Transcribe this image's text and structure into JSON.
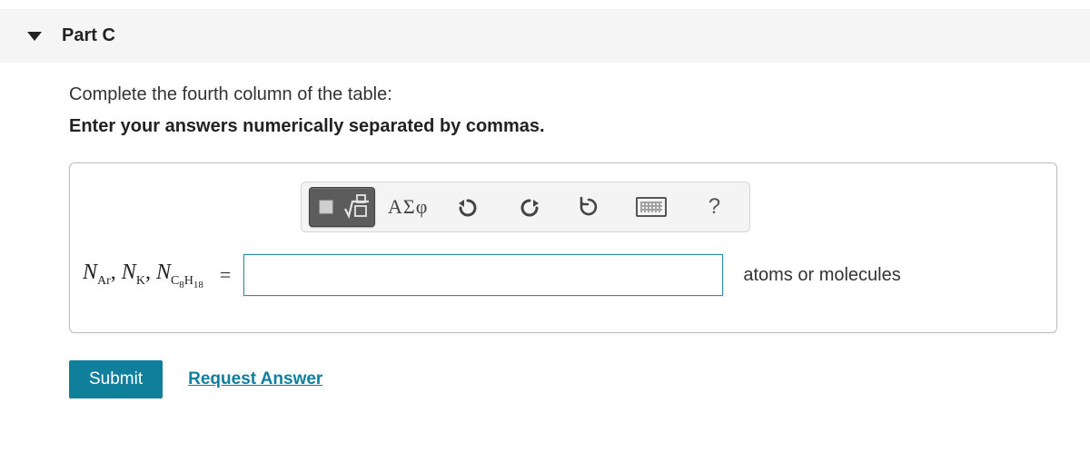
{
  "header": {
    "title": "Part C"
  },
  "prompt": {
    "line1": "Complete the fourth column of the table:",
    "line2": "Enter your answers numerically separated by commas."
  },
  "toolbar": {
    "template_icon": "template-radical-icon",
    "greek_label": "ΑΣφ",
    "undo_icon": "undo-icon",
    "redo_icon": "redo-icon",
    "reset_icon": "reset-icon",
    "keyboard_icon": "keyboard-icon",
    "help_label": "?"
  },
  "answer": {
    "variables_html": "N_Ar, N_K, N_C8H18",
    "variables_display": [
      {
        "base": "N",
        "sub": "Ar"
      },
      {
        "base": "N",
        "sub": "K"
      },
      {
        "base": "N",
        "sub": "C",
        "subExtra": "8",
        "sub2": "H",
        "sub2Extra": "18"
      }
    ],
    "equals": "=",
    "input_value": "",
    "input_placeholder": "",
    "unit_label": "atoms or molecules"
  },
  "actions": {
    "submit_label": "Submit",
    "request_answer_label": "Request Answer"
  }
}
